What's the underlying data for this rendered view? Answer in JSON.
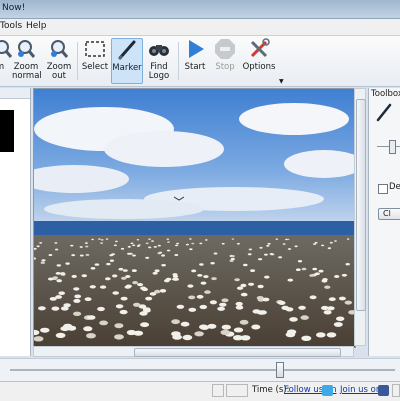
{
  "window": {
    "title": "Now!"
  },
  "menu": {
    "items": [
      "Tools",
      "Help"
    ]
  },
  "toolbar": {
    "buttons": [
      {
        "label_line1": "m",
        "label_line2": ""
      },
      {
        "label_line1": "Zoom",
        "label_line2": "normal"
      },
      {
        "label_line1": "Zoom",
        "label_line2": "out"
      },
      {
        "label_line1": "Select",
        "label_line2": ""
      },
      {
        "label_line1": "Marker",
        "label_line2": ""
      },
      {
        "label_line1": "Find",
        "label_line2": "Logo"
      },
      {
        "label_line1": "Start",
        "label_line2": ""
      },
      {
        "label_line1": "Stop",
        "label_line2": ""
      },
      {
        "label_line1": "Options",
        "label_line2": ""
      }
    ]
  },
  "toolbox": {
    "title": "Toolbox",
    "checkbox_label": "Des",
    "clear_label": "Cl"
  },
  "status": {
    "time_label": "Time (s):",
    "follow_label": "Follow us on",
    "join_label": "Join us on"
  },
  "colors": {
    "accent": "#2f7fd6",
    "active_bg": "#cde3f7",
    "sky": "#4f8fdc",
    "ocean": "#2c5fa3"
  }
}
